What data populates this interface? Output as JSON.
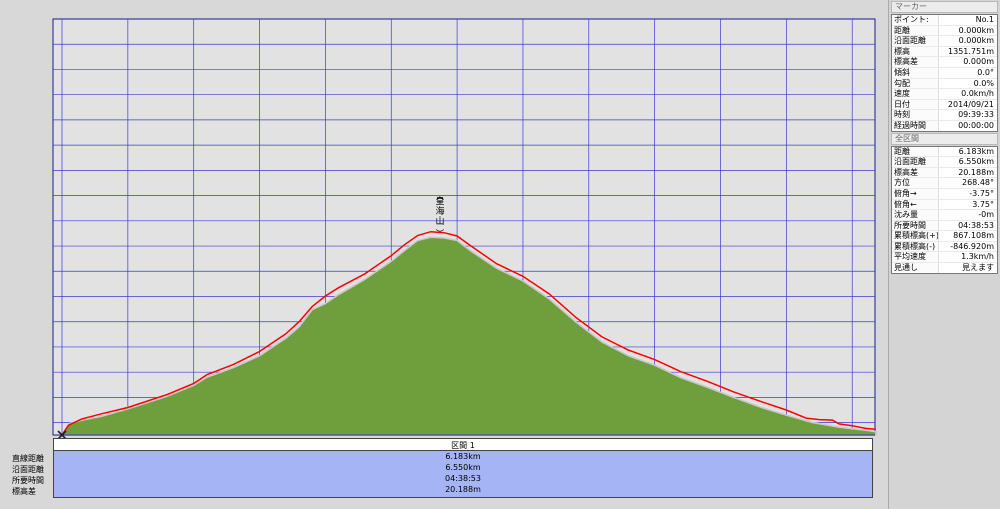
{
  "chart_data": {
    "type": "area",
    "x_unit": "[km]",
    "y_unit": "[m]",
    "xlim": [
      0,
      6.2
    ],
    "ylim": [
      1351,
      3000
    ],
    "x_ticks": [
      "0.0",
      "0.5",
      "1.0",
      "1.5",
      "2.0",
      "2.5",
      "3.0",
      "3.5",
      "4.0",
      "4.5",
      "5.0",
      "5.5",
      "6.0"
    ],
    "y_ticks": [
      "1351",
      "1400",
      "1500",
      "1600",
      "1700",
      "1800",
      "1900",
      "2000",
      "2100",
      "2200",
      "2300",
      "2400",
      "2500",
      "2600",
      "2700",
      "2800",
      "2900",
      "3000"
    ],
    "peak_label": "皇海山",
    "peak_x": 2.87,
    "series": [
      {
        "fill_color": "#6f9e3c",
        "points": [
          [
            0,
            1351
          ],
          [
            0.05,
            1395
          ],
          [
            0.15,
            1410
          ],
          [
            0.3,
            1425
          ],
          [
            0.5,
            1455
          ],
          [
            0.8,
            1505
          ],
          [
            1.0,
            1548
          ],
          [
            1.1,
            1580
          ],
          [
            1.3,
            1618
          ],
          [
            1.5,
            1665
          ],
          [
            1.7,
            1735
          ],
          [
            1.8,
            1780
          ],
          [
            1.9,
            1848
          ],
          [
            2.0,
            1872
          ],
          [
            2.1,
            1908
          ],
          [
            2.3,
            1968
          ],
          [
            2.5,
            2040
          ],
          [
            2.6,
            2082
          ],
          [
            2.7,
            2122
          ],
          [
            2.8,
            2135
          ],
          [
            2.9,
            2132
          ],
          [
            3.0,
            2122
          ],
          [
            3.1,
            2082
          ],
          [
            3.3,
            2012
          ],
          [
            3.5,
            1962
          ],
          [
            3.7,
            1890
          ],
          [
            3.9,
            1800
          ],
          [
            4.1,
            1720
          ],
          [
            4.3,
            1665
          ],
          [
            4.5,
            1628
          ],
          [
            4.7,
            1578
          ],
          [
            4.9,
            1540
          ],
          [
            5.1,
            1500
          ],
          [
            5.3,
            1462
          ],
          [
            5.5,
            1430
          ],
          [
            5.7,
            1400
          ],
          [
            5.9,
            1382
          ],
          [
            6.1,
            1370
          ],
          [
            6.18,
            1364
          ]
        ]
      },
      {
        "line_color": "#ff0000",
        "points": [
          [
            0,
            1351
          ],
          [
            0.05,
            1390
          ],
          [
            0.15,
            1415
          ],
          [
            0.3,
            1435
          ],
          [
            0.5,
            1460
          ],
          [
            0.8,
            1512
          ],
          [
            1.0,
            1555
          ],
          [
            1.1,
            1590
          ],
          [
            1.3,
            1630
          ],
          [
            1.5,
            1682
          ],
          [
            1.7,
            1752
          ],
          [
            1.8,
            1800
          ],
          [
            1.9,
            1860
          ],
          [
            2.0,
            1902
          ],
          [
            2.1,
            1935
          ],
          [
            2.3,
            1990
          ],
          [
            2.5,
            2062
          ],
          [
            2.6,
            2105
          ],
          [
            2.7,
            2142
          ],
          [
            2.8,
            2157
          ],
          [
            2.9,
            2153
          ],
          [
            3.0,
            2140
          ],
          [
            3.1,
            2102
          ],
          [
            3.3,
            2030
          ],
          [
            3.5,
            1980
          ],
          [
            3.7,
            1910
          ],
          [
            3.9,
            1818
          ],
          [
            4.1,
            1740
          ],
          [
            4.3,
            1688
          ],
          [
            4.5,
            1650
          ],
          [
            4.7,
            1602
          ],
          [
            4.9,
            1564
          ],
          [
            5.1,
            1522
          ],
          [
            5.3,
            1485
          ],
          [
            5.5,
            1450
          ],
          [
            5.65,
            1418
          ],
          [
            5.75,
            1412
          ],
          [
            5.85,
            1410
          ],
          [
            5.9,
            1395
          ],
          [
            6.0,
            1388
          ],
          [
            6.1,
            1377
          ],
          [
            6.18,
            1374
          ]
        ]
      }
    ]
  },
  "sidebar": {
    "marker_header": "マーカー",
    "marker_rows": [
      {
        "k": "ポイント:",
        "v": "No.1"
      },
      {
        "k": "距離",
        "v": "0.000km"
      },
      {
        "k": "沿面距離",
        "v": "0.000km"
      },
      {
        "k": "標高",
        "v": "1351.751m"
      },
      {
        "k": "標高差",
        "v": "0.000m"
      },
      {
        "k": "傾斜",
        "v": "0.0°"
      },
      {
        "k": "勾配",
        "v": "0.0%"
      },
      {
        "k": "速度",
        "v": "0.0km/h"
      },
      {
        "k": "日付",
        "v": "2014/09/21"
      },
      {
        "k": "時刻",
        "v": "09:39:33"
      },
      {
        "k": "経過時間",
        "v": "00:00:00"
      }
    ],
    "full_header": "全区間",
    "full_rows": [
      {
        "k": "距離",
        "v": "6.183km"
      },
      {
        "k": "沿面距離",
        "v": "6.550km"
      },
      {
        "k": "標高差",
        "v": "20.188m"
      },
      {
        "k": "方位",
        "v": "268.48°"
      },
      {
        "k": "俯角→",
        "v": "-3.75°"
      },
      {
        "k": "俯角←",
        "v": "3.75°"
      },
      {
        "k": "沈み量",
        "v": "-0m"
      },
      {
        "k": "所要時間",
        "v": "04:38:53"
      },
      {
        "k": "累積標高(+)",
        "v": "867.108m"
      },
      {
        "k": "累積標高(-)",
        "v": "-846.920m"
      },
      {
        "k": "平均速度",
        "v": "1.3km/h"
      },
      {
        "k": "見通し",
        "v": "見えます"
      }
    ]
  },
  "segment": {
    "header": "区間 1",
    "labels": [
      "直線距離",
      "沿面距離",
      "所要時間",
      "標高差"
    ],
    "values": [
      "6.183km",
      "6.550km",
      "04:38:53",
      "20.188m"
    ]
  }
}
